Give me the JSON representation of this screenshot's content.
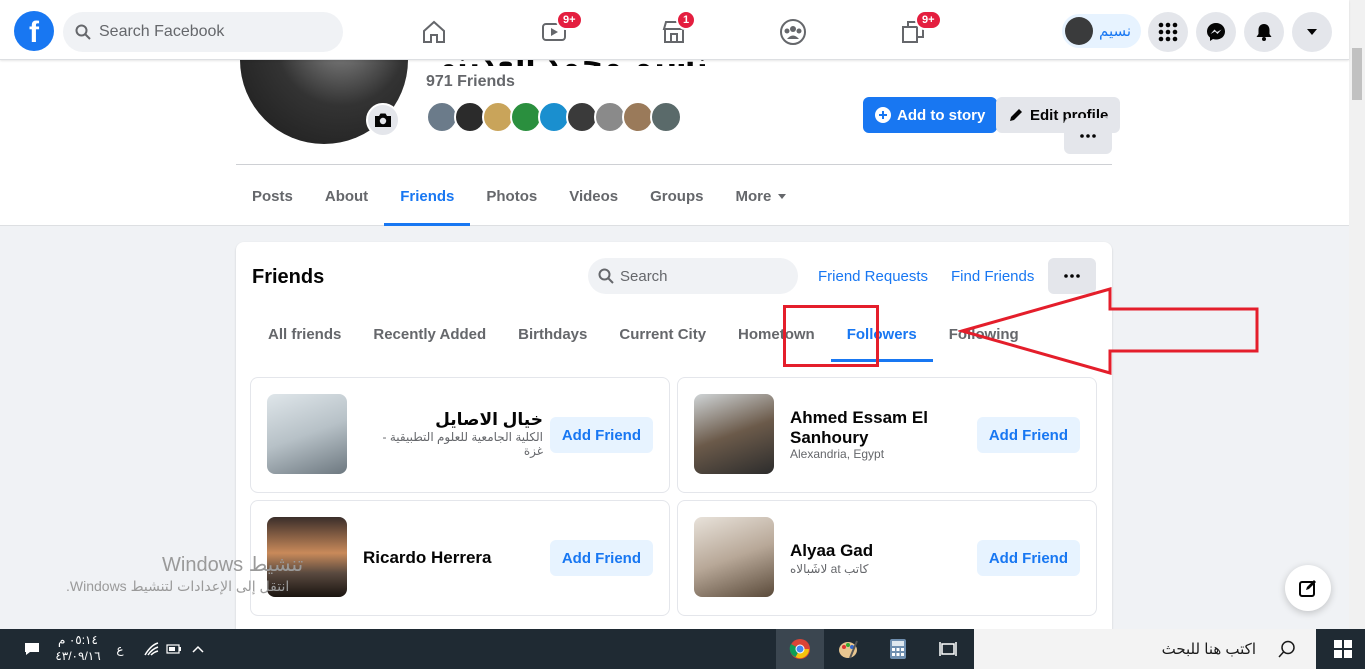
{
  "topnav": {
    "search_placeholder": "Search Facebook",
    "badges": {
      "watch": "9+",
      "marketplace": "1",
      "gaming": "9+"
    },
    "profile_name": "نسيم"
  },
  "profile": {
    "name": "نسيم محمد العديني",
    "friend_count": "971 Friends",
    "add_story_label": "Add to story",
    "edit_profile_label": "Edit profile",
    "tabs": [
      "Posts",
      "About",
      "Friends",
      "Photos",
      "Videos",
      "Groups",
      "More"
    ],
    "active_tab": "Friends"
  },
  "friends_card": {
    "title": "Friends",
    "search_placeholder": "Search",
    "friend_requests_label": "Friend Requests",
    "find_friends_label": "Find Friends",
    "subtabs": [
      "All friends",
      "Recently Added",
      "Birthdays",
      "Current City",
      "Hometown",
      "Followers",
      "Following"
    ],
    "active_subtab": "Followers",
    "tiles": [
      {
        "name": "خيال الاصايل",
        "sub": "الكلية الجامعية للعلوم التطبيقية - غزة",
        "button": "Add Friend"
      },
      {
        "name": "Ahmed Essam El Sanhoury",
        "sub": "Alexandria, Egypt",
        "button": "Add Friend"
      },
      {
        "name": "Ricardo Herrera",
        "sub": "",
        "button": "Add Friend"
      },
      {
        "name": "Alyaa Gad",
        "sub": "كاتب at لاشَبالاه",
        "button": "Add Friend"
      }
    ]
  },
  "watermark": {
    "line1": "تنشيط Windows",
    "line2": "انتقل إلى الإعدادات لتنشيط Windows."
  },
  "taskbar": {
    "time": "٠٥:١٤ م",
    "date": "٤٣/٠٩/١٦",
    "lang": "ع",
    "search_placeholder": "اكتب هنا للبحث"
  },
  "colors": {
    "brand": "#1877f2",
    "annotation": "#e41e2b"
  }
}
